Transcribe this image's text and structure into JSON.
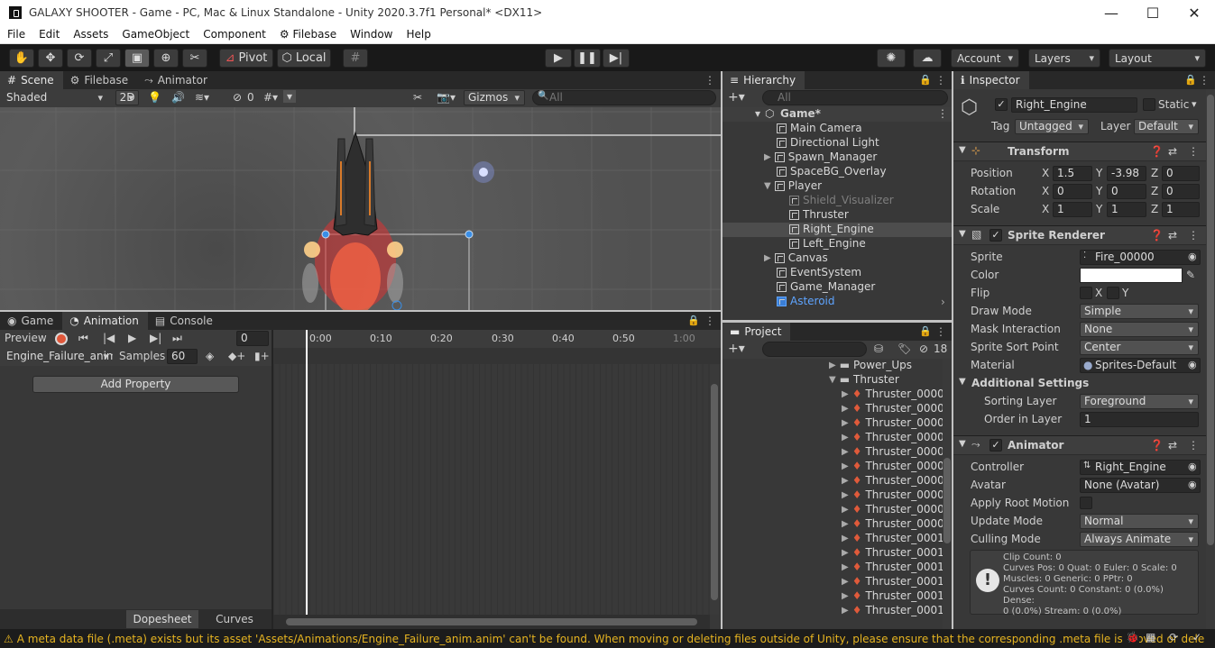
{
  "window": {
    "title": "GALAXY SHOOTER - Game - PC, Mac & Linux Standalone - Unity 2020.3.7f1 Personal* <DX11>"
  },
  "menu": [
    "File",
    "Edit",
    "Assets",
    "GameObject",
    "Component",
    "Filebase",
    "Window",
    "Help"
  ],
  "toolbar": {
    "pivot": "Pivot",
    "local": "Local",
    "account": "Account",
    "layers": "Layers",
    "layout": "Layout"
  },
  "scene": {
    "tabs": [
      "Scene",
      "Filebase",
      "Animator"
    ],
    "shading": "Shaded",
    "mode2d": "2D",
    "hidden_count": "0",
    "gizmos": "Gizmos",
    "search_placeholder": "All"
  },
  "animation": {
    "tabs": [
      "Game",
      "Animation",
      "Console"
    ],
    "preview": "Preview",
    "frame": "0",
    "clip": "Engine_Failure_anim",
    "samples_label": "Samples",
    "samples": "60",
    "add_property": "Add Property",
    "ticks": [
      "0:00",
      "0:10",
      "0:20",
      "0:30",
      "0:40",
      "0:50",
      "1:00"
    ],
    "dopesheet": "Dopesheet",
    "curves": "Curves"
  },
  "hierarchy": {
    "tab": "Hierarchy",
    "search_placeholder": "All",
    "root": "Game*",
    "items": [
      "Main Camera",
      "Directional Light",
      "Spawn_Manager",
      "SpaceBG_Overlay",
      "Player",
      "Shield_Visualizer",
      "Thruster",
      "Right_Engine",
      "Left_Engine",
      "Canvas",
      "EventSystem",
      "Game_Manager",
      "Asteroid"
    ]
  },
  "project": {
    "tab": "Project",
    "badge": "18",
    "folders": [
      "Power_Ups",
      "Thruster"
    ],
    "files": [
      "Thruster_0000",
      "Thruster_0000",
      "Thruster_0000",
      "Thruster_0000",
      "Thruster_0000",
      "Thruster_0000",
      "Thruster_0000",
      "Thruster_0000",
      "Thruster_0000",
      "Thruster_0000",
      "Thruster_0001",
      "Thruster_0001",
      "Thruster_0001",
      "Thruster_0001",
      "Thruster_0001",
      "Thruster_0001"
    ]
  },
  "inspector": {
    "tab": "Inspector",
    "name": "Right_Engine",
    "static": "Static",
    "tag_label": "Tag",
    "tag": "Untagged",
    "layer_label": "Layer",
    "layer": "Default",
    "transform": {
      "title": "Transform",
      "position": "Position",
      "rotation": "Rotation",
      "scale": "Scale",
      "x": "X",
      "y": "Y",
      "z": "Z",
      "pos": [
        "1.5",
        "-3.98",
        "0"
      ],
      "rot": [
        "0",
        "0",
        "0"
      ],
      "scl": [
        "1",
        "1",
        "1"
      ]
    },
    "sprite_renderer": {
      "title": "Sprite Renderer",
      "sprite_label": "Sprite",
      "sprite": "Fire_00000",
      "color_label": "Color",
      "flip_label": "Flip",
      "flip_x": "X",
      "flip_y": "Y",
      "draw_mode_label": "Draw Mode",
      "draw_mode": "Simple",
      "mask_label": "Mask Interaction",
      "mask": "None",
      "sort_point_label": "Sprite Sort Point",
      "sort_point": "Center",
      "material_label": "Material",
      "material": "Sprites-Default",
      "additional": "Additional Settings",
      "sorting_layer_label": "Sorting Layer",
      "sorting_layer": "Foreground",
      "order_label": "Order in Layer",
      "order": "1"
    },
    "animator": {
      "title": "Animator",
      "controller_label": "Controller",
      "controller": "Right_Engine",
      "avatar_label": "Avatar",
      "avatar": "None (Avatar)",
      "root_motion_label": "Apply Root Motion",
      "update_label": "Update Mode",
      "update": "Normal",
      "culling_label": "Culling Mode",
      "culling": "Always Animate",
      "info": [
        "Clip Count: 0",
        "Curves Pos: 0 Quat: 0 Euler: 0 Scale: 0",
        "Muscles: 0 Generic: 0 PPtr: 0",
        "Curves Count: 0 Constant: 0 (0.0%) Dense:",
        "0 (0.0%) Stream: 0 (0.0%)"
      ]
    }
  },
  "status": "A meta data file (.meta) exists but its asset 'Assets/Animations/Engine_Failure_anim.anim' can't be found. When moving or deleting files outside of Unity, please ensure that the corresponding .meta file is moved or dele"
}
